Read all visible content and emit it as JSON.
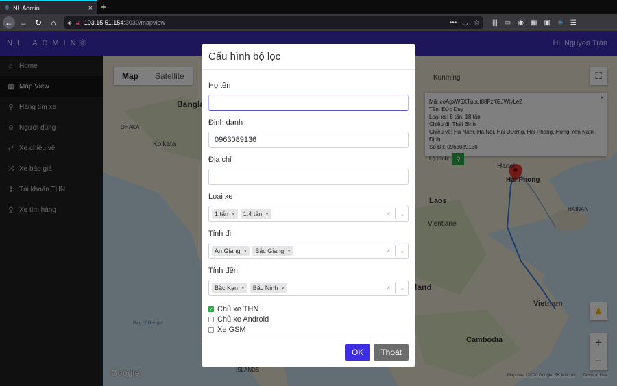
{
  "browser": {
    "tab_title": "NL Admin",
    "url_host": "103.15.51.154",
    "url_path": ":3030/mapview"
  },
  "app": {
    "brand": "NL ADMIN",
    "user": "Hi, Nguyen Tran"
  },
  "sidebar": {
    "items": [
      {
        "label": "Home",
        "icon": "home-icon"
      },
      {
        "label": "Map View",
        "icon": "map-icon",
        "active": true
      },
      {
        "label": "Hàng tìm xe",
        "icon": "pin-icon"
      },
      {
        "label": "Người dùng",
        "icon": "users-icon"
      },
      {
        "label": "Xe chiều về",
        "icon": "route-icon"
      },
      {
        "label": "Xe báo giá",
        "icon": "shuffle-icon"
      },
      {
        "label": "Tài khoản THN",
        "icon": "key-icon"
      },
      {
        "label": "Xe tìm hàng",
        "icon": "pin-icon"
      }
    ]
  },
  "map": {
    "type_map": "Map",
    "type_satellite": "Satellite",
    "labels": {
      "bangla": "Bangla",
      "dhaka": "DHAKA",
      "kolkata": "Kolkata",
      "kunming": "Kunming",
      "laos": "Laos",
      "vientiane": "Vientiane",
      "vietnam": "Vietnam",
      "cambodia": "Cambodia",
      "haiphong": "Hai Phong",
      "hanoi": "Hanoi",
      "hainan": "HAINAN",
      "land": "land",
      "bayofbengal": "Bay of Bengal",
      "islands": "ISLANDS"
    },
    "info": {
      "line1": "Mã: coAgxW6XTpuut88Fzf09JWIyLe2",
      "line2": "Tên: Đức Duy",
      "line3": "Loại xe: 8 tấn, 18 tấn",
      "line4": "Chiều đi: Thái Bình",
      "line5": "Chiều về: Hà Nam, Hà Nội, Hải Dương, Hải Phòng, Hưng Yên Nam Định",
      "line6": "Số ĐT: 0963089136",
      "route_label": "Lộ trình:"
    },
    "google": "Google",
    "attribution": "Map data ©2020 Google, SK telecom",
    "terms": "Terms of Use",
    "zoom_in": "+",
    "zoom_out": "−"
  },
  "modal": {
    "title": "Cấu hình bộ lọc",
    "name_label": "Họ tên",
    "name_value": "",
    "id_label": "Định danh",
    "id_value": "0963089136",
    "addr_label": "Địa chỉ",
    "addr_value": "",
    "vehicle_label": "Loại xe",
    "vehicle_chips": [
      "1 tấn",
      "1.4 tấn"
    ],
    "from_label": "Tỉnh đi",
    "from_chips": [
      "An Giang",
      "Bắc Giang"
    ],
    "to_label": "Tỉnh đến",
    "to_chips": [
      "Bắc Kạn",
      "Bắc Ninh"
    ],
    "checks": [
      {
        "label": "Chủ xe THN",
        "checked": true
      },
      {
        "label": "Chủ xe Android",
        "checked": false
      },
      {
        "label": "Xe GSM",
        "checked": false
      }
    ],
    "ok": "OK",
    "exit": "Thoát"
  }
}
